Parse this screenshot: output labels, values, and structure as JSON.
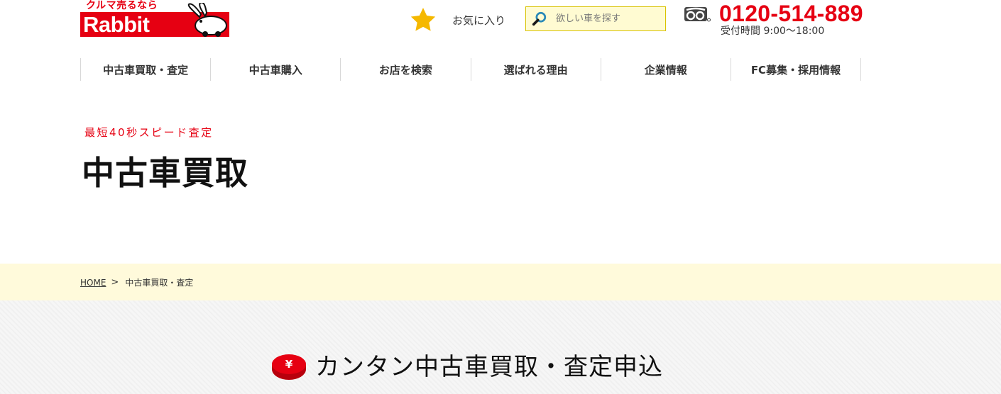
{
  "header": {
    "logo_tagline": "クルマ売るなら",
    "logo_text": "Rabbit",
    "favorites_label": "お気に入り",
    "search_placeholder": "欲しい車を探す",
    "phone_number": "0120-514-889",
    "business_hours": "受付時間 9:00〜18:00"
  },
  "nav": {
    "items": [
      {
        "label": "中古車買取・査定"
      },
      {
        "label": "中古車購入"
      },
      {
        "label": "お店を検索"
      },
      {
        "label": "選ばれる理由"
      },
      {
        "label": "企業情報"
      },
      {
        "label": "FC募集・採用情報"
      }
    ]
  },
  "hero": {
    "subtitle": "最短40秒スピード査定",
    "title": "中古車買取"
  },
  "breadcrumb": {
    "home": "HOME",
    "separator": ">",
    "current": "中古車買取・査定"
  },
  "section": {
    "title": "カンタン中古車買取・査定申込",
    "icon_symbol": "¥"
  },
  "colors": {
    "brand_red": "#e60012",
    "star_yellow": "#f5b800",
    "search_bg": "#fffbd2",
    "breadcrumb_bg": "#fffadb"
  }
}
